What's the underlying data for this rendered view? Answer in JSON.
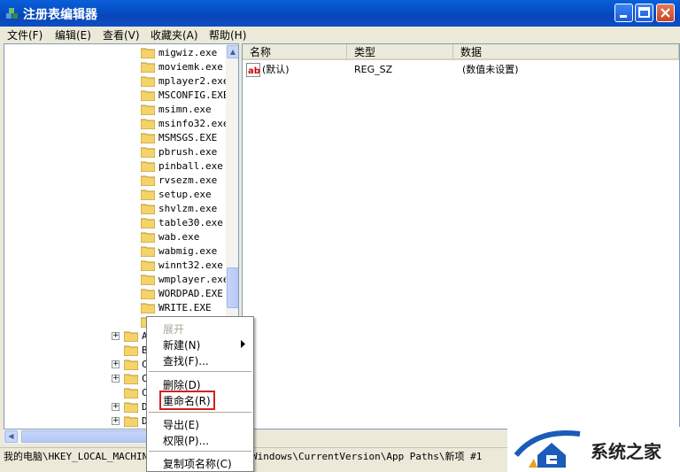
{
  "window": {
    "title": "注册表编辑器"
  },
  "menu": [
    "文件(F)",
    "编辑(E)",
    "查看(V)",
    "收藏夹(A)",
    "帮助(H)"
  ],
  "tree": {
    "items": [
      "migwiz.exe",
      "moviemk.exe",
      "mplayer2.exe",
      "MSCONFIG.EXE",
      "msimn.exe",
      "msinfo32.exe",
      "MSMSGS.EXE",
      "pbrush.exe",
      "pinball.exe",
      "rvsezm.exe",
      "setup.exe",
      "shvlzm.exe",
      "table30.exe",
      "wab.exe",
      "wabmig.exe",
      "winnt32.exe",
      "wmplayer.exe",
      "WORDPAD.EXE",
      "WRITE.EXE"
    ],
    "lower_items": [
      "A",
      "B",
      "C",
      "C",
      "C",
      "D",
      "D"
    ]
  },
  "list": {
    "columns": [
      "名称",
      "类型",
      "数据"
    ],
    "rows": [
      {
        "name": "(默认)",
        "type": "REG_SZ",
        "data": "(数值未设置)"
      }
    ]
  },
  "status": {
    "left": "我的电脑\\HKEY_LOCAL_MACHINE",
    "right": "Windows\\CurrentVersion\\App Paths\\新项 #1"
  },
  "context_menu": {
    "expand": "展开",
    "new": "新建(N)",
    "find": "查找(F)...",
    "delete": "删除(D)",
    "rename": "重命名(R)",
    "export": "导出(E)",
    "permissions": "权限(P)...",
    "copy_key": "复制项名称(C)"
  },
  "watermark": {
    "text": "系统之家"
  },
  "colors": {
    "title_bar": "#0550c8",
    "highlight": "#d42020",
    "folder": "#f4d36b"
  }
}
